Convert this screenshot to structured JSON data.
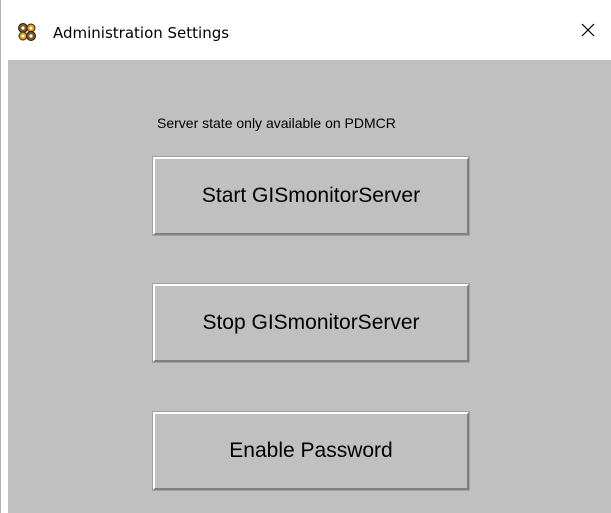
{
  "window": {
    "title": "Administration Settings",
    "app_icon": "cogwheels-icon",
    "close_icon": "close-icon",
    "colors": {
      "client_background": "#c0c0c0",
      "titlebar_background": "#ffffff"
    }
  },
  "content": {
    "status_label": "Server state only available on PDMCR",
    "buttons": {
      "start_label": "Start GISmonitorServer",
      "stop_label": "Stop GISmonitorServer",
      "password_label": "Enable Password"
    }
  }
}
